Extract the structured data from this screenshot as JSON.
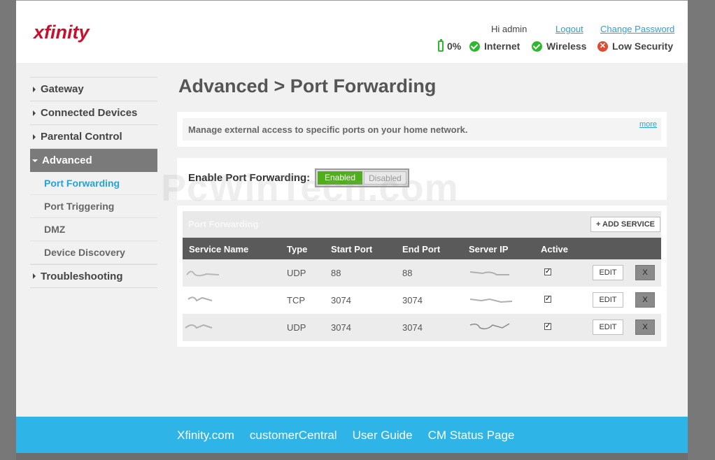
{
  "header": {
    "logo": "xfinity",
    "greeting": "Hi admin",
    "logout": "Logout",
    "change_password": "Change Password",
    "status": [
      {
        "icon": "battery-icon",
        "label": "0%"
      },
      {
        "icon": "check-icon",
        "label": "Internet"
      },
      {
        "icon": "check-icon",
        "label": "Wireless"
      },
      {
        "icon": "x-icon",
        "label": "Low Security"
      }
    ]
  },
  "nav": {
    "items": [
      {
        "label": "Gateway"
      },
      {
        "label": "Connected Devices"
      },
      {
        "label": "Parental Control"
      },
      {
        "label": "Advanced"
      }
    ],
    "subitems": [
      {
        "label": "Port Forwarding"
      },
      {
        "label": "Port Triggering"
      },
      {
        "label": "DMZ"
      },
      {
        "label": "Device Discovery"
      }
    ],
    "last": {
      "label": "Troubleshooting"
    }
  },
  "page": {
    "title": "Advanced > Port Forwarding",
    "description": "Manage external access to specific ports on your home network.",
    "more": "more",
    "toggle_label": "Enable Port Forwarding:",
    "toggle_on": "Enabled",
    "toggle_off": "Disabled",
    "enabled": true
  },
  "table": {
    "title": "Port Forwarding",
    "add_button": "+ ADD SERVICE",
    "headers": [
      "Service Name",
      "Type",
      "Start Port",
      "End Port",
      "Server IP",
      "Active"
    ],
    "rows": [
      {
        "type": "UDP",
        "start": "88",
        "end": "88",
        "active": true
      },
      {
        "type": "TCP",
        "start": "3074",
        "end": "3074",
        "active": true
      },
      {
        "type": "UDP",
        "start": "3074",
        "end": "3074",
        "active": true
      }
    ],
    "edit_label": "EDIT",
    "delete_label": "X"
  },
  "watermark": "PcWinTech.com",
  "footer": {
    "links": [
      "Xfinity.com",
      "customerCentral",
      "User Guide",
      "CM Status Page"
    ]
  },
  "colors": {
    "accent": "#2aa1d5",
    "footer": "#2fb4e8",
    "logo": "#c8102e",
    "enabled": "#4fae1c",
    "ok": "#2eb82e",
    "warn": "#e04a2e"
  }
}
